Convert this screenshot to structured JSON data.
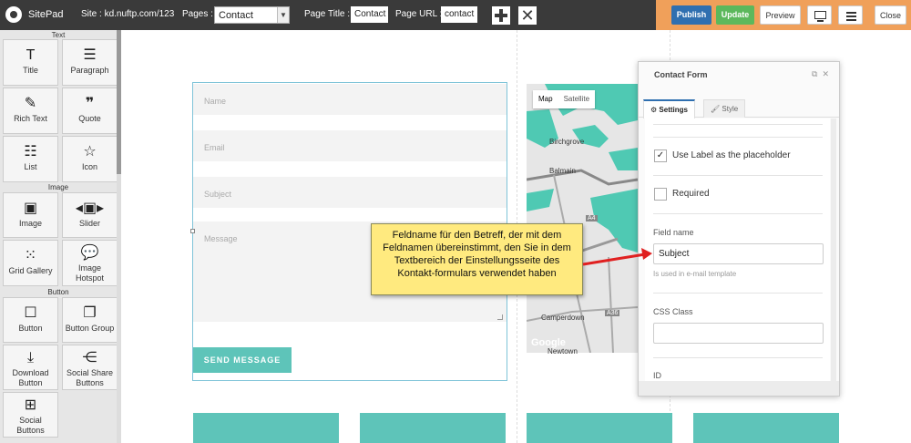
{
  "topbar": {
    "brand": "SitePad",
    "site_label": "Site : kd.nuftp.com/123",
    "pages_label": "Pages :",
    "pages_value": "Contact",
    "page_title_label": "Page Title :",
    "page_title_value": "Contact",
    "page_url_label": "Page URL :",
    "page_url_value": "contact",
    "publish": "Publish",
    "update": "Update",
    "preview": "Preview",
    "close": "Close",
    "accent_color": "#f0a05a"
  },
  "left_panel": {
    "sections": [
      "Text",
      "Image",
      "Button"
    ],
    "widgets": [
      {
        "label": "Title",
        "icon": "title-icon"
      },
      {
        "label": "Paragraph",
        "icon": "paragraph-icon"
      },
      {
        "label": "Rich Text",
        "icon": "rich-text-icon"
      },
      {
        "label": "Quote",
        "icon": "quote-icon"
      },
      {
        "label": "List",
        "icon": "list-icon"
      },
      {
        "label": "Icon",
        "icon": "star-icon"
      },
      {
        "label": "Image",
        "icon": "image-icon"
      },
      {
        "label": "Slider",
        "icon": "slider-icon"
      },
      {
        "label": "Grid Gallery",
        "icon": "grid-icon"
      },
      {
        "label": "Image Hotspot",
        "icon": "hotspot-icon"
      },
      {
        "label": "Button",
        "icon": "button-icon"
      },
      {
        "label": "Button Group",
        "icon": "button-group-icon"
      },
      {
        "label": "Download Button",
        "icon": "download-icon"
      },
      {
        "label": "Social Share Buttons",
        "icon": "share-icon"
      },
      {
        "label": "Social Buttons",
        "icon": "social-icon"
      }
    ]
  },
  "form": {
    "name_placeholder": "Name",
    "email_placeholder": "Email",
    "subject_placeholder": "Subject",
    "message_placeholder": "Message",
    "send": "SEND MESSAGE"
  },
  "map": {
    "tab_map": "Map",
    "tab_satellite": "Satellite",
    "places": [
      "Birchgrove",
      "Balmain",
      "Camperdown",
      "Newtown"
    ],
    "roads": [
      "A4",
      "A36"
    ],
    "logo": "Google"
  },
  "contact_form_panel": {
    "title": "Contact Form",
    "tab_settings": "Settings",
    "tab_style": "Style",
    "use_label_placeholder": "Use Label as the placeholder",
    "use_label_checked": true,
    "required": "Required",
    "required_checked": false,
    "field_name_label": "Field name",
    "field_name_value": "Subject",
    "field_name_hint": "Is used in e-mail template",
    "css_class_label": "CSS Class",
    "css_class_value": "",
    "id_label": "ID"
  },
  "callout": {
    "text": "Feldname für den Betreff, der mit dem Feldnamen übereinstimmt, den Sie in dem Textbereich der Einstellungsseite des Kontakt-formulars verwendet haben"
  }
}
